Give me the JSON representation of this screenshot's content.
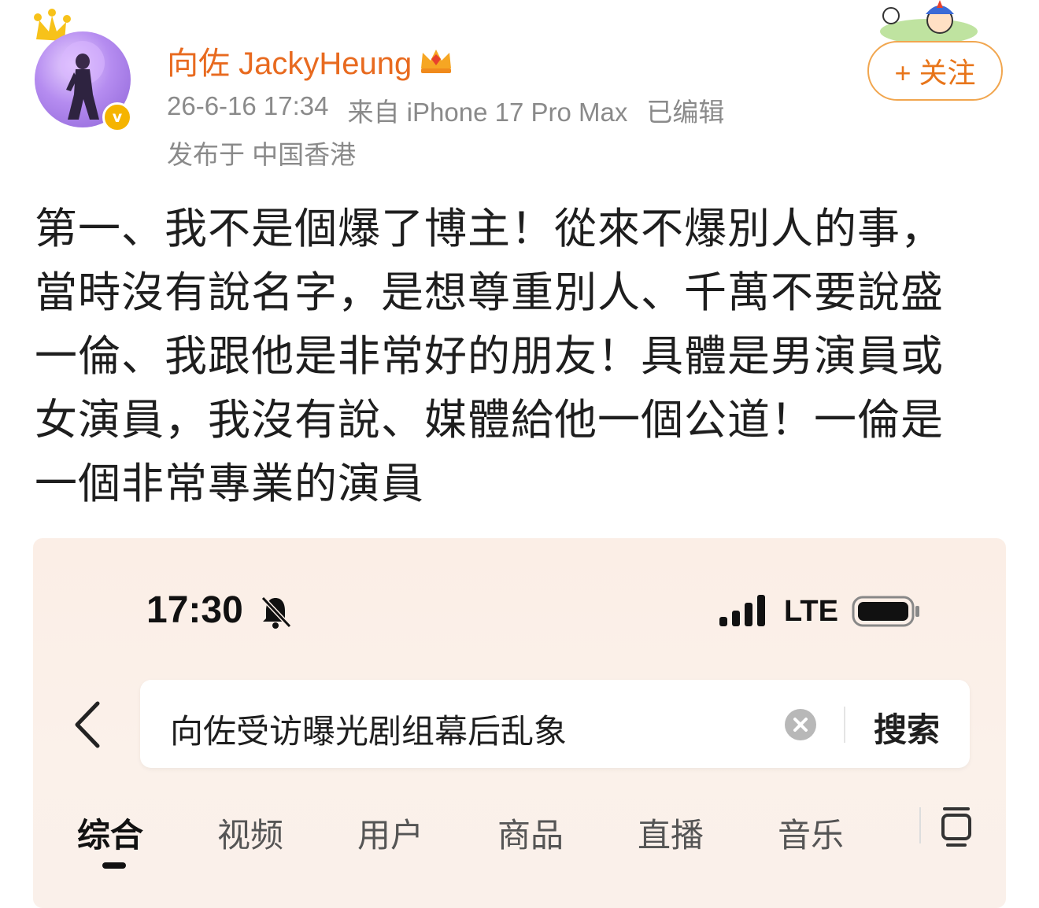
{
  "post": {
    "author": {
      "name": "向佐 JackyHeung",
      "verified_badge": "v",
      "avatar_icon": "avatar-photo",
      "crown_icon": "crown-icon",
      "vip_icon": "vip-crown-icon"
    },
    "meta": {
      "timestamp": "26-6-16 17:34",
      "source": "来自 iPhone 17 Pro Max",
      "edited": "已编辑",
      "location": "发布于 中国香港"
    },
    "follow_label": "+ 关注",
    "content_lines": [
      "第一、我不是個爆了博主！從來不爆別人的事，",
      "當時沒有說名字，是想尊重別人、千萬不要說盛",
      "一倫、我跟他是非常好的朋友！具體是男演員或",
      "女演員，我沒有說、媒體給他一個公道！一倫是",
      "一個非常專業的演員"
    ]
  },
  "screenshot": {
    "status_bar": {
      "time": "17:30",
      "network": "LTE"
    },
    "search": {
      "query": "向佐受访曝光剧组幕后乱象",
      "button": "搜索"
    },
    "tabs": [
      {
        "label": "综合",
        "active": true
      },
      {
        "label": "视频",
        "active": false
      },
      {
        "label": "用户",
        "active": false
      },
      {
        "label": "商品",
        "active": false
      },
      {
        "label": "直播",
        "active": false
      },
      {
        "label": "音乐",
        "active": false
      }
    ]
  },
  "colors": {
    "username": "#e86a1f",
    "follow_border": "#f1a64f",
    "meta_text": "#8a8a8a",
    "badge": "#f5b400"
  }
}
